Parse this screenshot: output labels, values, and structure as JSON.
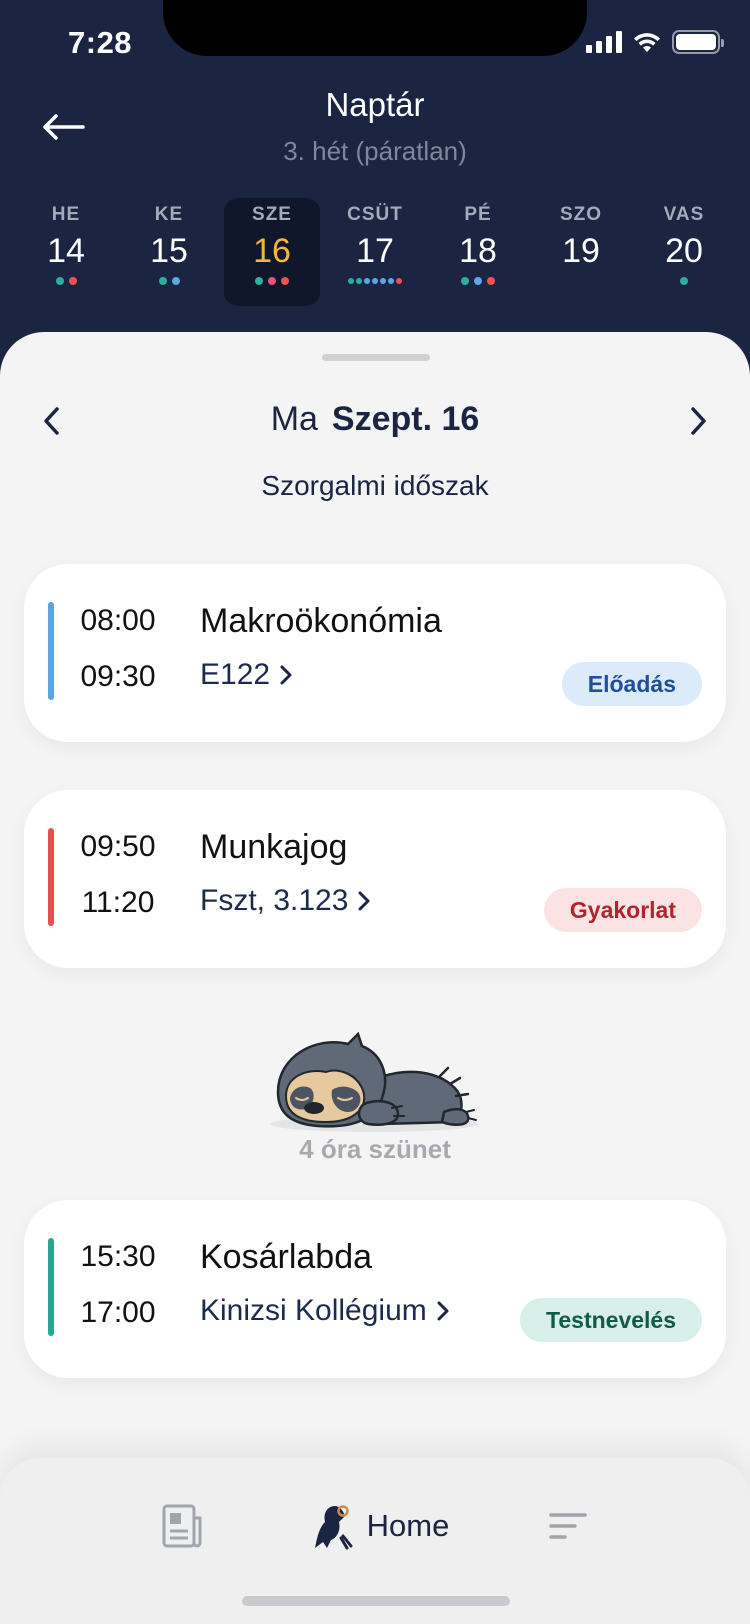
{
  "status_bar": {
    "time": "7:28"
  },
  "header": {
    "title": "Naptár",
    "subtitle": "3. hét (páratlan)",
    "back_icon": "arrow-left-icon"
  },
  "week": [
    {
      "name": "HE",
      "num": "14",
      "dots": [
        "#2bb0a0",
        "#ef5350"
      ]
    },
    {
      "name": "KE",
      "num": "15",
      "dots": [
        "#2bb0a0",
        "#5aa8e6"
      ]
    },
    {
      "name": "SZE",
      "num": "16",
      "dots": [
        "#2bb0a0",
        "#ec4f7c",
        "#ef5350"
      ],
      "selected": true
    },
    {
      "name": "CSÜT",
      "num": "17",
      "dots": [
        "#2bb0a0",
        "#2bb0a0",
        "#5aa8e6",
        "#5aa8e6",
        "#5aa8e6",
        "#5aa8e6",
        "#ef5350"
      ]
    },
    {
      "name": "PÉ",
      "num": "18",
      "dots": [
        "#2bb0a0",
        "#5aa8e6",
        "#ef5350"
      ]
    },
    {
      "name": "SZO",
      "num": "19",
      "dots": []
    },
    {
      "name": "VAS",
      "num": "20",
      "dots": [
        "#2bb0a0"
      ]
    }
  ],
  "day_view": {
    "prefix": "Ma",
    "date": "Szept. 16",
    "period": "Szorgalmi időszak"
  },
  "lessons": [
    {
      "start": "08:00",
      "end": "09:30",
      "title": "Makroökonómia",
      "location": "E122",
      "type": "Előadás",
      "accent": "#5ba4de",
      "badge_bg": "#dcebf9",
      "badge_fg": "#1f4f9a"
    },
    {
      "start": "09:50",
      "end": "11:20",
      "title": "Munkajog",
      "location": "Fszt, 3.123",
      "type": "Gyakorlat",
      "accent": "#e84e4e",
      "badge_bg": "#fbe3e3",
      "badge_fg": "#b3232b"
    },
    {
      "start": "15:30",
      "end": "17:00",
      "title": "Kosárlabda",
      "location": "Kinizsi Kollégium",
      "type": "Testnevelés",
      "accent": "#24a892",
      "badge_bg": "#d7eee9",
      "badge_fg": "#0f5c46"
    }
  ],
  "break": {
    "text": "4 óra szünet",
    "illustration": "sleeping-sloth"
  },
  "tabbar": {
    "news_icon": "newspaper-icon",
    "home_icon": "bird-logo-icon",
    "home_label": "Home",
    "menu_icon": "menu-icon"
  }
}
